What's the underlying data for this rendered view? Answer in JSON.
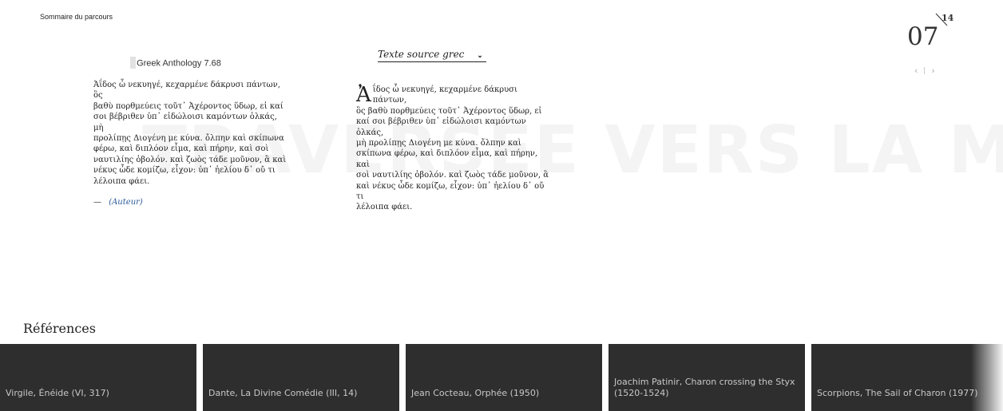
{
  "nav": {
    "summary_link": "Sommaire du parcours"
  },
  "watermark": "TRAVERSÉE VERS LA M...",
  "counter": {
    "current": "07",
    "total": "14",
    "prev_label": "‹",
    "next_label": "›"
  },
  "left": {
    "title": "Greek Anthology 7.68",
    "lines": [
      "Ἀΐδος ὦ νεκυηγέ, κεχαρμένε δάκρυσι πάντων, ὃς",
      "βαθὺ πορθμεύεις τοῦτ᾽ Ἀχέροντος ὕδωρ, εἰ καί",
      "σοι βέβριθεν ὑπ᾽ εἰδώλοισι καμόντων ὁλκάς, μὴ",
      "προλίπῃς Διογένη με κύνα. ὄλπην καὶ σκίπωνα",
      "φέρω, καὶ διπλόον εἷμα, καὶ πήρην, καὶ σοὶ",
      "ναυτιλίης ὀβολόν. καὶ ζωὸς τάδε μοῦνον, ἃ καὶ",
      "νέκυς ὧδε κομίζω, εἶχον: ὑπ᾽ ἠελίου δ᾽ οὔ τι",
      "λέλοιπα φάει."
    ],
    "author_dash": "—",
    "author_link": "(Auteur)"
  },
  "source": {
    "selector_label": "Texte source grec",
    "chevron": "⌄",
    "dropcap": "Ἀ",
    "lines": [
      "ΐδος ὦ νεκυηγέ, κεχαρμένε δάκρυσι πάντων,",
      "ὃς βαθὺ πορθμεύεις τοῦτ᾽ Ἀχέροντος ὕδωρ, εἰ",
      "καί σοι βέβριθεν ὑπ᾽ εἰδώλοισι καμόντων ὁλκάς,",
      "μὴ προλίπῃς Διογένη με κύνα. ὄλπην καὶ",
      "σκίπωνα φέρω, καὶ διπλόον εἷμα, καὶ πήρην, καὶ",
      "σοὶ ναυτιλίης ὀβολόν. καὶ ζωὸς τάδε μοῦνον, ἃ",
      "καὶ νέκυς ὧδε κομίζω, εἶχον: ὑπ᾽ ἠελίου δ᾽ οὔ τι",
      "λέλοιπα φάει."
    ]
  },
  "references": {
    "title": "Références",
    "items": [
      "Virgile, Énéide (VI, 317)",
      "Dante, La Divine Comédie (III, 14)",
      "Jean Cocteau, Orphée (1950)",
      "Joachim Patinir, Charon crossing the Styx (1520-1524)",
      "Scorpions, The Sail of Charon (1977)"
    ]
  },
  "colors": {
    "card_bg": "#2e2e2e",
    "card_text": "#c8c8c8",
    "author_link": "#2b5b9a"
  }
}
